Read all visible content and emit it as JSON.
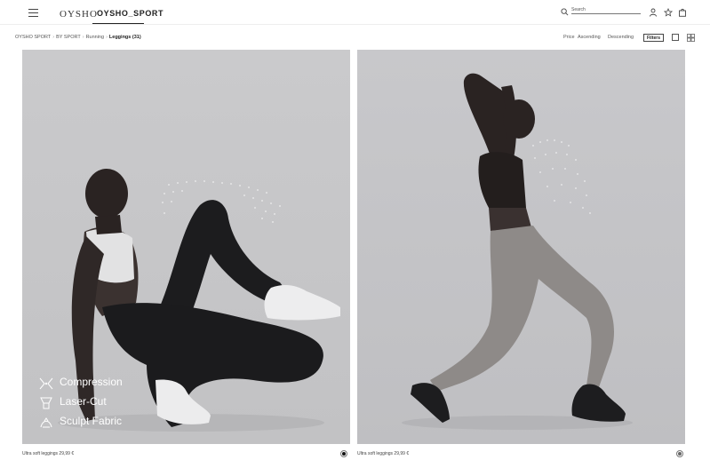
{
  "header": {
    "logo": "OYSHO",
    "sport_tab": "OYSHO_SPORT",
    "search_placeholder": "Search"
  },
  "breadcrumb": {
    "items": [
      "OYSHO SPORT",
      "BY SPORT",
      "Running"
    ],
    "current": "Leggings (31)"
  },
  "sort": {
    "price_label": "Price",
    "ascending_label": "Ascending",
    "descending_label": "Descending",
    "filters_label": "Filters"
  },
  "products": [
    {
      "name": "Ultra soft leggings",
      "price": "29,99 €",
      "swatch_color": "#111111",
      "features": [
        {
          "icon": "compression-icon",
          "label": "Compression"
        },
        {
          "icon": "laser-cut-icon",
          "label": "Laser-Cut"
        },
        {
          "icon": "sculpt-icon",
          "label": "Sculpt Fabric"
        }
      ]
    },
    {
      "name": "Ultra soft leggings",
      "price": "29,99 €",
      "swatch_color": "#666666"
    }
  ],
  "colors": {
    "accent": "#222222",
    "image_bg": "#c6c6c8"
  }
}
